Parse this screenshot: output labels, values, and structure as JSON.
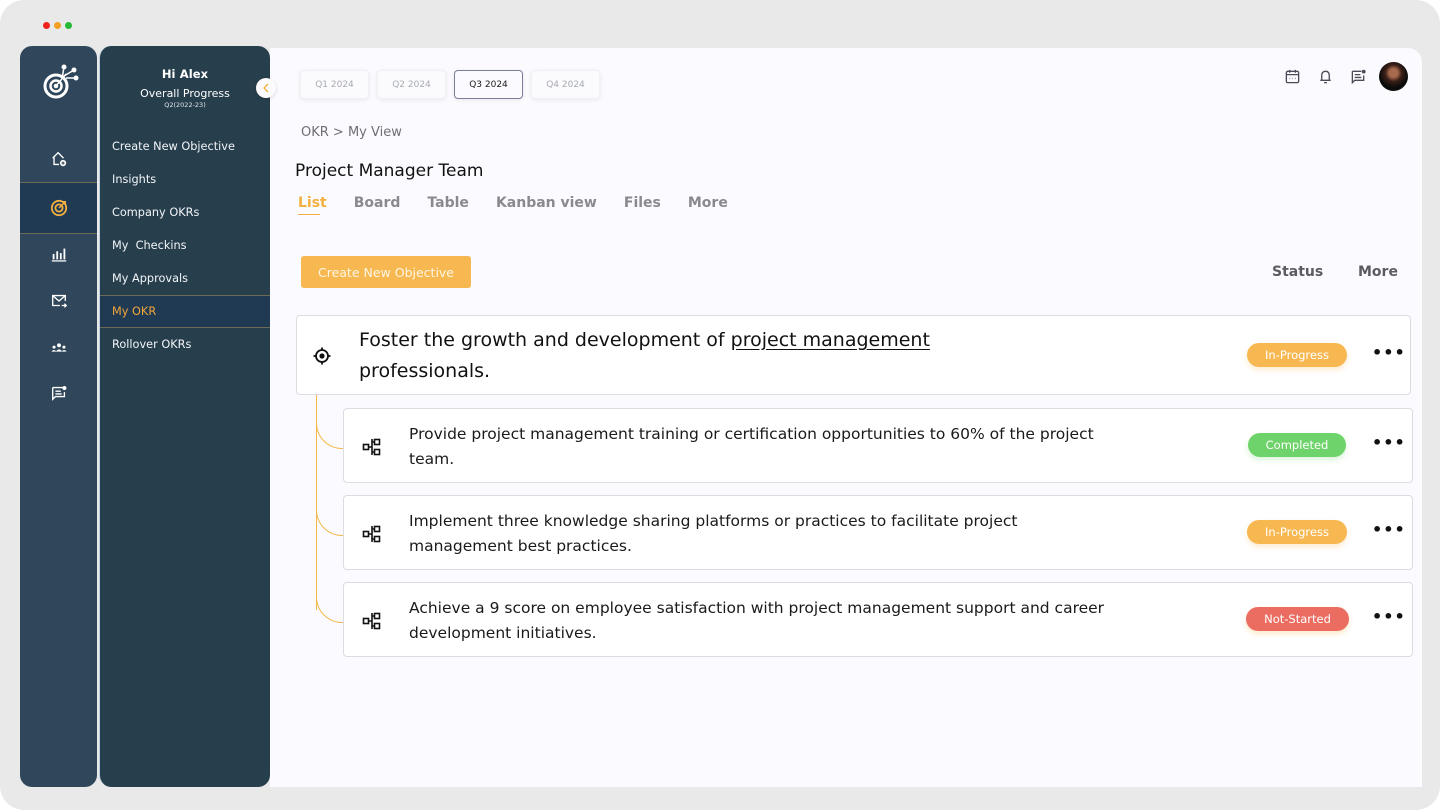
{
  "window": {
    "controls": [
      "close",
      "minimize",
      "maximize"
    ]
  },
  "rail": {
    "logo_icon": "target-network-logo-icon",
    "items": [
      {
        "name": "home",
        "icon": "home-add-icon",
        "active": false
      },
      {
        "name": "okr",
        "icon": "target-icon",
        "active": true
      },
      {
        "name": "reports",
        "icon": "bar-chart-icon",
        "active": false
      },
      {
        "name": "messages",
        "icon": "mail-forward-icon",
        "active": false
      },
      {
        "name": "teams",
        "icon": "people-group-icon",
        "active": false
      },
      {
        "name": "feedback",
        "icon": "chat-notification-icon",
        "active": false
      }
    ]
  },
  "nav": {
    "greeting": "Hi Alex",
    "progress_label": "Overall Progress",
    "progress_period": "Q2(2022-23)",
    "items": [
      {
        "label": "Create New Objective",
        "active": false
      },
      {
        "label": "Insights",
        "active": false
      },
      {
        "label": "Company OKRs",
        "active": false
      },
      {
        "label": "My  Checkins",
        "active": false
      },
      {
        "label": "My Approvals",
        "active": false
      },
      {
        "label": "My OKR",
        "active": true
      },
      {
        "label": "Rollover OKRs",
        "active": false
      }
    ]
  },
  "header": {
    "quarters": [
      {
        "label": "Q1 2024",
        "active": false
      },
      {
        "label": "Q2 2024",
        "active": false
      },
      {
        "label": "Q3 2024",
        "active": true
      },
      {
        "label": "Q4 2024",
        "active": false
      }
    ],
    "icons": [
      "calendar-icon",
      "bell-icon",
      "chat-notification-icon"
    ]
  },
  "breadcrumb": "OKR > My View",
  "page_title": "Project Manager Team",
  "tabs": [
    {
      "label": "List",
      "active": true
    },
    {
      "label": "Board",
      "active": false
    },
    {
      "label": "Table",
      "active": false
    },
    {
      "label": "Kanban view",
      "active": false
    },
    {
      "label": "Files",
      "active": false
    },
    {
      "label": "More",
      "active": false
    }
  ],
  "toolbar": {
    "create_label": "Create New Objective",
    "status_label": "Status",
    "more_label": "More"
  },
  "objective": {
    "text_before": "Foster the growth and development of ",
    "text_link": "project management",
    "text_after": " professionals.",
    "status": "In-Progress",
    "menu": "•••"
  },
  "key_results": [
    {
      "text": "Provide project management training or certification opportunities to 60% of the project team.",
      "status": "Completed",
      "menu": "•••"
    },
    {
      "text": "Implement three knowledge sharing platforms or practices to facilitate project management best practices.",
      "status": "In-Progress",
      "menu": "•••"
    },
    {
      "text": "Achieve a 9 score on employee satisfaction with project management support and career development initiatives.",
      "status": "Not-Started",
      "menu": "•••"
    }
  ],
  "colors": {
    "accent": "#f3b041",
    "in_progress": "#f7b851",
    "completed": "#6fd36b",
    "not_started": "#eb6d62",
    "sidebar": "#273e4d",
    "rail": "#30475b"
  }
}
